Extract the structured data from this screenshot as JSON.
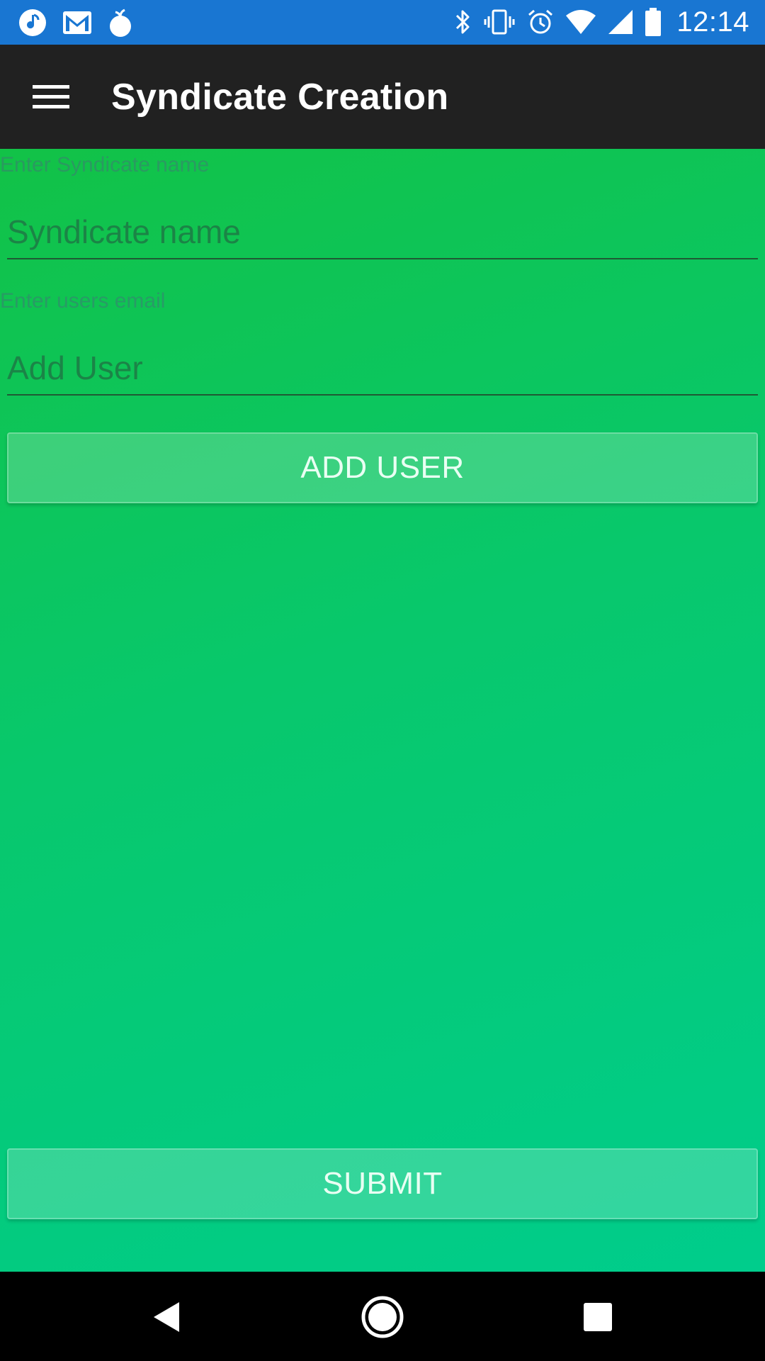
{
  "status_bar": {
    "time": "12:14",
    "left_icons": [
      "music-icon",
      "gmail-icon",
      "droplet-app-icon"
    ],
    "right_icons": [
      "bluetooth-icon",
      "vibrate-icon",
      "alarm-icon",
      "wifi-icon",
      "cell-signal-icon",
      "battery-icon"
    ],
    "background": "#1976d2"
  },
  "app_bar": {
    "title": "Syndicate Creation",
    "menu_icon": "hamburger-menu-icon",
    "background": "#212121"
  },
  "form": {
    "syndicate_hint": "Enter Syndicate name",
    "syndicate_placeholder": "Syndicate name",
    "email_hint": "Enter users email",
    "email_placeholder": "Add User",
    "add_user_label": "ADD USER",
    "submit_label": "SUBMIT",
    "gradient_start": "#12c247",
    "gradient_end": "#00cd8c"
  },
  "nav_bar": {
    "icons": [
      "back-icon",
      "home-icon",
      "recents-icon"
    ]
  }
}
